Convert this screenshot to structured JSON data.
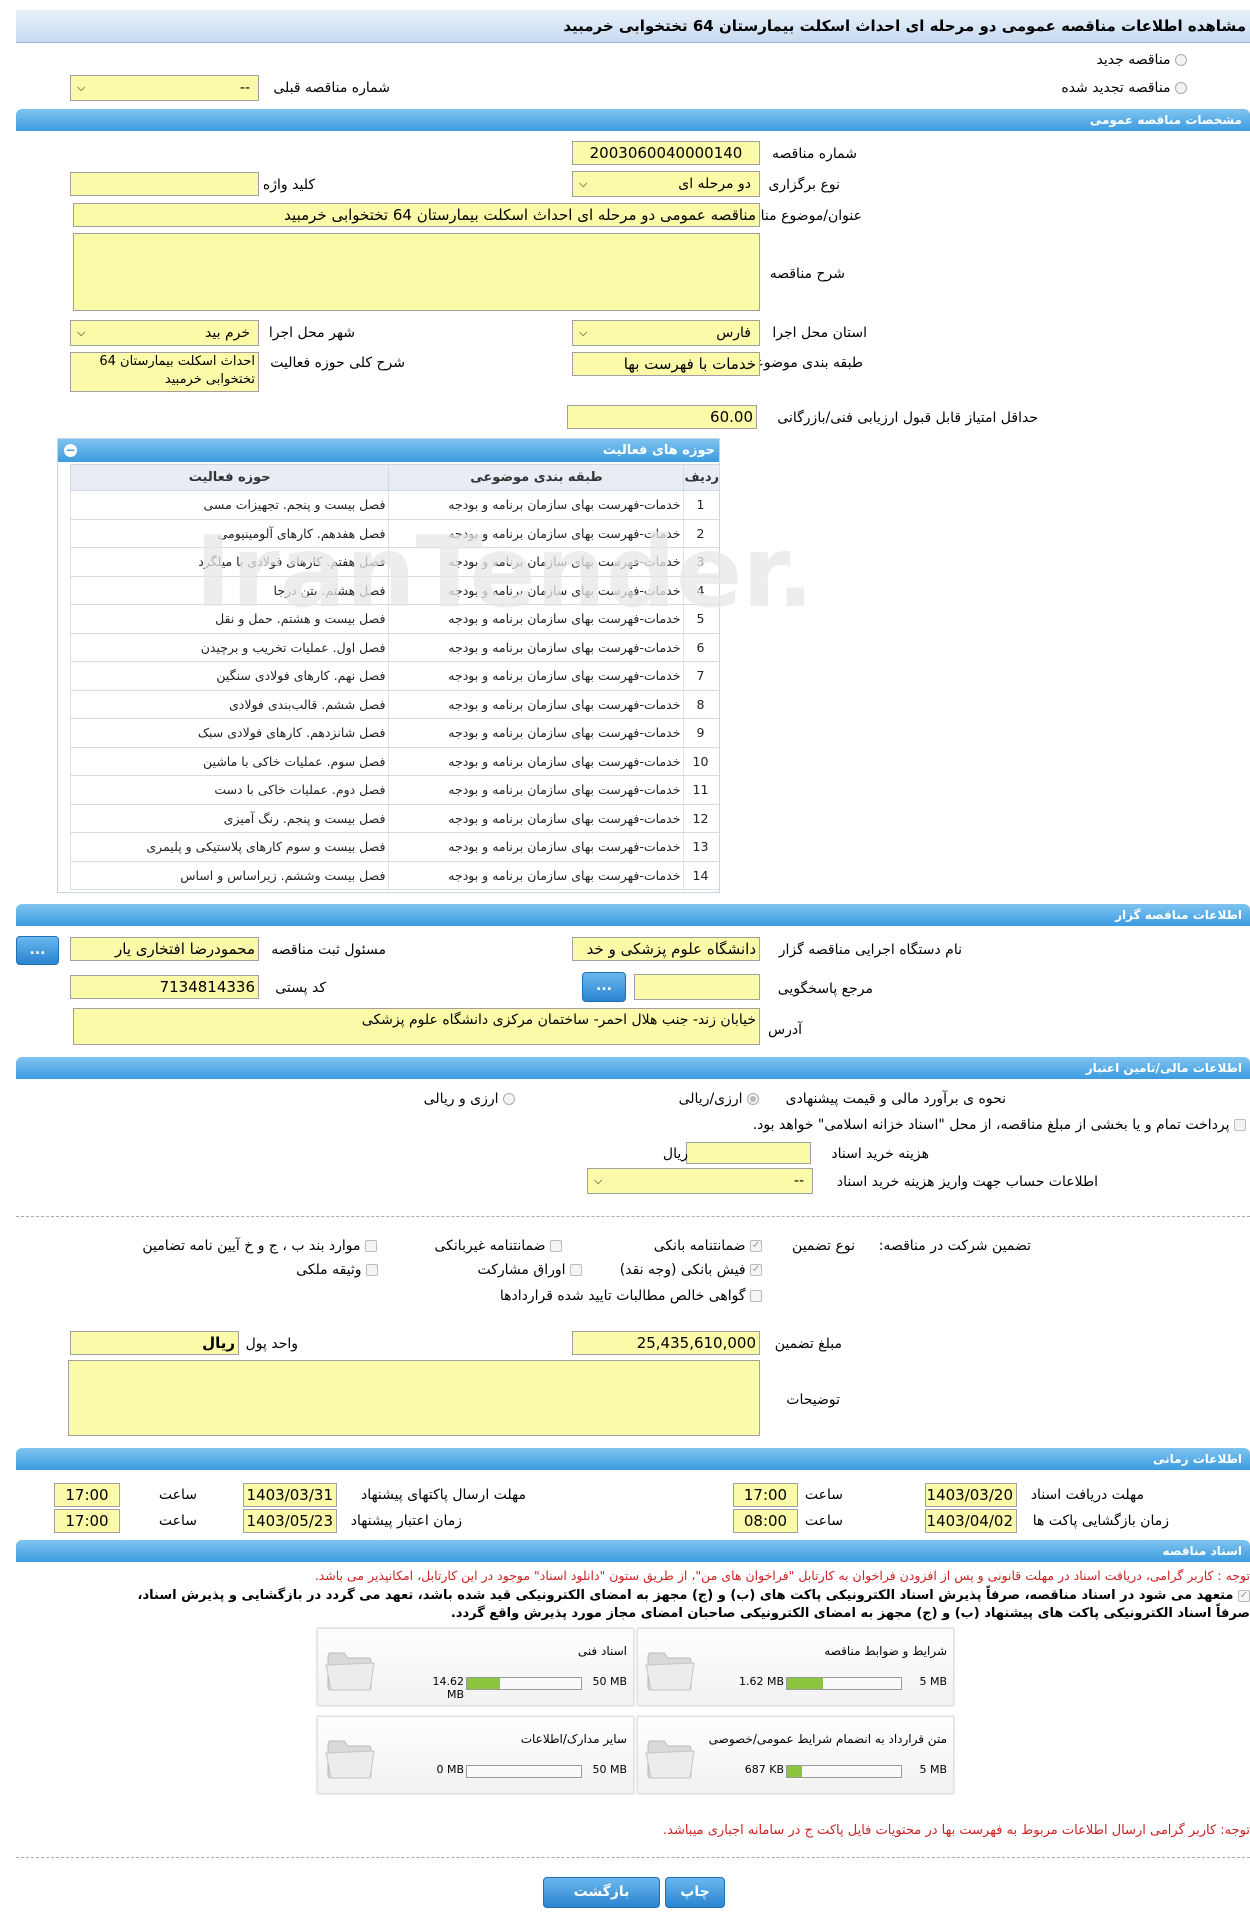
{
  "title": "مشاهده اطلاعات مناقصه عمومی دو مرحله ای احداث اسکلت بیمارستان 64 تختخوابی خرمبید",
  "top": {
    "new_tender": "مناقصه جدید",
    "renewed_tender": "مناقصه تجدید شده",
    "previous_no_label": "شماره مناقصه قبلی",
    "previous_no_value": "--"
  },
  "general": {
    "header": "مشخصات مناقصه عمومی",
    "tender_no_label": "شماره مناقصه",
    "tender_no": "2003060040000140",
    "type_label": "نوع برگزاری",
    "type": "دو مرحله ای",
    "keyword_label": "کلید واژه",
    "keyword": "",
    "subject_label": "عنوان/موضوع مناقصه",
    "subject": "مناقصه عمومی دو مرحله ای احداث اسکلت بیمارستان 64 تختخوابی خرمبید",
    "description_label": "شرح مناقصه",
    "description": "",
    "province_label": "استان محل اجرا",
    "province": "فارس",
    "city_label": "شهر محل اجرا",
    "city": "خرم بید",
    "category_label": "طبقه بندی موضوعی",
    "category": "خدمات با فهرست بها",
    "activity_desc_label": "شرح کلی حوزه فعالیت",
    "activity_desc": "احداث اسکلت بیمارستان 64 تختخوابی خرمبید",
    "min_score_label": "حداقل امتیاز قابل قبول ارزیابی فنی/بازرگانی",
    "min_score": "60.00"
  },
  "activities": {
    "header": "حوزه های فعالیت",
    "columns": [
      "ردیف",
      "طبقه بندی موضوعی",
      "حوزه فعالیت"
    ],
    "rows": [
      [
        "1",
        "خدمات-فهرست بهای سازمان برنامه و بودجه",
        "فصل بیست و پنجم. تجهیزات مسی"
      ],
      [
        "2",
        "خدمات-فهرست بهای سازمان برنامه و بودجه",
        "فصل هفدهم. کارهای آلومینیومی"
      ],
      [
        "3",
        "خدمات-فهرست بهای سازمان برنامه و بودجه",
        "فصل هفتم. کارهای فولادی با میلگرد"
      ],
      [
        "4",
        "خدمات-فهرست بهای سازمان برنامه و بودجه",
        "فصل هشتم. بتن درجا"
      ],
      [
        "5",
        "خدمات-فهرست بهای سازمان برنامه و بودجه",
        "فصل بیست و هشتم. حمل و نقل"
      ],
      [
        "6",
        "خدمات-فهرست بهای سازمان برنامه و بودجه",
        "فصل اول. عملیات تخریب و برچیدن"
      ],
      [
        "7",
        "خدمات-فهرست بهای سازمان برنامه و بودجه",
        "فصل نهم. کارهای فولادی سنگین"
      ],
      [
        "8",
        "خدمات-فهرست بهای سازمان برنامه و بودجه",
        "فصل ششم. قالب‌بندی فولادی"
      ],
      [
        "9",
        "خدمات-فهرست بهای سازمان برنامه و بودجه",
        "فصل شانزدهم. کارهای فولادی سبک"
      ],
      [
        "10",
        "خدمات-فهرست بهای سازمان برنامه و بودجه",
        "فصل سوم. عملیات خاکی با ماشین"
      ],
      [
        "11",
        "خدمات-فهرست بهای سازمان برنامه و بودجه",
        "فصل دوم. عملیات خاکی با دست"
      ],
      [
        "12",
        "خدمات-فهرست بهای سازمان برنامه و بودجه",
        "فصل بیست و پنجم. رنگ آمیزی"
      ],
      [
        "13",
        "خدمات-فهرست بهای سازمان برنامه و بودجه",
        "فصل بیست و سوم کارهای پلاستیکی و پلیمری"
      ],
      [
        "14",
        "خدمات-فهرست بهای سازمان برنامه و بودجه",
        "فصل بیست وششم. زیراساس و اساس"
      ]
    ]
  },
  "organizer": {
    "header": "اطلاعات مناقصه گزار",
    "agency_label": "نام دستگاه اجرایی مناقصه گزار",
    "agency": "دانشگاه علوم پزشکی و خد",
    "registrar_label": "مسئول ثبت مناقصه",
    "registrar": "محمودرضا افتخاری یار",
    "registrar_btn": "...",
    "ref_label": "مرجع پاسخگویی",
    "ref": "",
    "ref_btn": "...",
    "postal_label": "کد پستی",
    "postal": "7134814336",
    "address_label": "آدرس",
    "address": "خیابان زند- جنب هلال احمر- ساختمان مرکزی دانشگاه علوم پزشکی"
  },
  "financial": {
    "header": "اطلاعات مالی/تامین اعتبار",
    "estimate_label": "نحوه ی برآورد مالی و قیمت پیشنهادی",
    "opt_rial": "ارزی/ریالی",
    "opt_currency": "ارزی و ریالی",
    "treasury_text": "پرداخت تمام و یا بخشی از مبلغ مناقصه، از محل \"اسناد خزانه اسلامی\" خواهد بود.",
    "doc_cost_label": "هزینه خرید اسناد",
    "doc_cost_unit": "ریال",
    "account_label": "اطلاعات حساب جهت واریز هزینه خرید اسناد",
    "account": "--",
    "guarantee_label": "تضمین شرکت در مناقصه:",
    "guarantee_type_label": "نوع تضمین",
    "g_bank": "ضمانتنامه بانکی",
    "g_nonbank": "ضمانتنامه غیربانکی",
    "g_clauses": "موارد بند ب ، ج و خ آیین نامه تضامین",
    "g_receipt": "فیش بانکی (وجه نقد)",
    "g_bonds": "اوراق مشارکت",
    "g_property": "وثیقه ملکی",
    "g_claims": "گواهی خالص مطالبات تایید شده قراردادها",
    "amount_label": "مبلغ تضمین",
    "amount": "25,435,610,000",
    "currency_label": "واحد پول",
    "currency": "ریال",
    "notes_label": "توضیحات",
    "notes": ""
  },
  "schedule": {
    "header": "اطلاعات زمانی",
    "receive_label": "مهلت دریافت اسناد",
    "receive_date": "1403/03/20",
    "receive_time": "17:00",
    "send_label": "مهلت ارسال پاکتهای پیشنهاد",
    "send_date": "1403/03/31",
    "send_time": "17:00",
    "open_label": "زمان بازگشایی پاکت ها",
    "open_date": "1403/04/02",
    "open_time": "08:00",
    "validity_label": "زمان اعتبار پیشنهاد",
    "validity_date": "1403/05/23",
    "validity_time": "17:00",
    "time_label": "ساعت"
  },
  "documents": {
    "header": "اسناد مناقصه",
    "note1": "توجه : کاربر گرامی، دریافت اسناد در مهلت قانونی و پس از افزودن فراخوان به کارتابل \"فراخوان های من\"، از طریق ستون \"دانلود اسناد\" موجود در این کارتابل، امکانپذیر می باشد.",
    "commit1": "متعهد می شود در اسناد مناقصه، صرفاً پذیرش اسناد الکترونیکی پاکت های (ب) و (ج) مجهز به امضای الکترونیکی قید شده باشد، تعهد می گردد در بازگشایی و پذیرش اسناد،",
    "commit2": "صرفاً اسناد الکترونیکی پاکت های پیشنهاد (ب) و (ج) مجهز به امضای الکترونیکی صاحبان امضای مجاز مورد پذیرش واقع گردد.",
    "files": [
      {
        "title": "شرایط و ضوابط مناقصه",
        "size": "1.62 MB",
        "max": "5 MB",
        "fill": 0.32
      },
      {
        "title": "اسناد فنی",
        "size": "14.62 MB",
        "max": "50 MB",
        "fill": 0.29
      },
      {
        "title": "متن قرارداد به انضمام شرایط عمومی/خصوصی",
        "size": "687 KB",
        "max": "5 MB",
        "fill": 0.13
      },
      {
        "title": "سایر مدارک/اطلاعات",
        "size": "0 MB",
        "max": "50 MB",
        "fill": 0.0
      }
    ],
    "note2": "توجه: کاربر گرامی ارسال اطلاعات مربوط به فهرست بها در محتویات فایل پاکت ج در سامانه اجباری میباشد."
  },
  "actions": {
    "back": "بازگشت",
    "print": "چاپ"
  },
  "colors": {
    "accent": "#3c9be0",
    "field": "#fafaa8",
    "warning": "#cc2222"
  }
}
